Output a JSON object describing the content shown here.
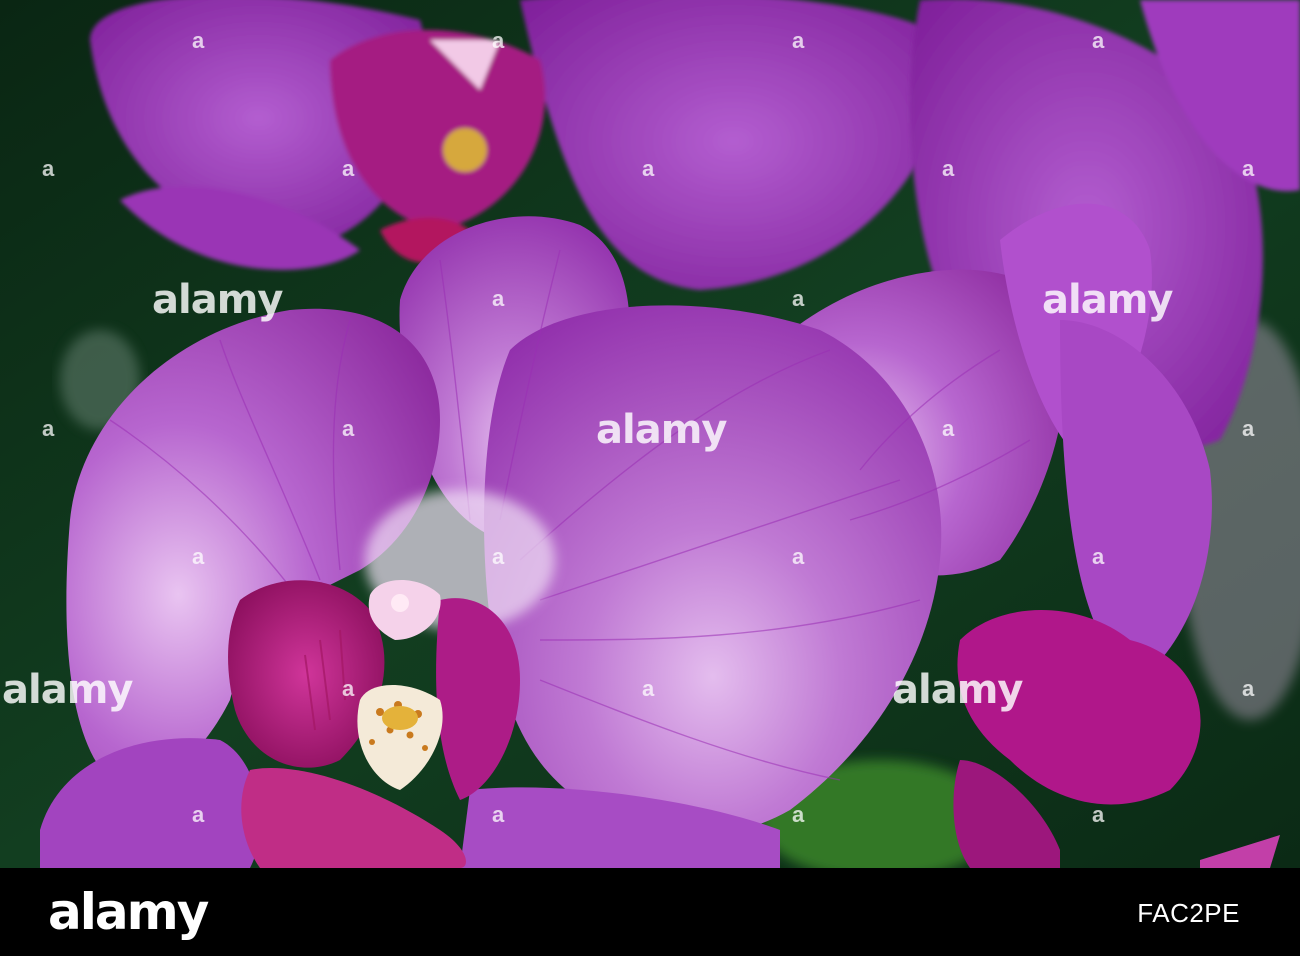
{
  "watermark": {
    "word": "alamy",
    "dot": "a"
  },
  "footer": {
    "logo": "alamy",
    "image_id": "FAC2PE"
  },
  "colors": {
    "petal_main": "#a83fc0",
    "petal_light": "#d9a6e6",
    "petal_dark": "#7a1f8f",
    "lip_magenta": "#b01478",
    "background_green": "#0f3a1c",
    "column_yellow": "#e3b53c",
    "bar_background": "#000000"
  }
}
